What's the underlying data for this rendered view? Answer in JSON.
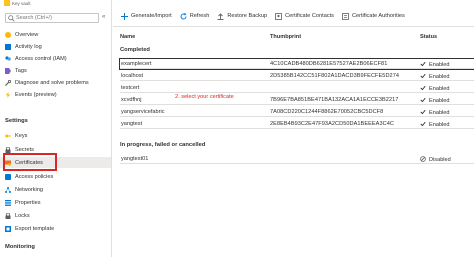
{
  "sidebar": {
    "brand": "Key vault",
    "search_placeholder": "Search (Ctrl+/)",
    "collapse_icon": "chevron-double-left-icon",
    "items": [
      {
        "label": "Overview",
        "icon": "overview-icon",
        "color": "#ffb900"
      },
      {
        "label": "Activity log",
        "icon": "activity-log-icon",
        "color": "#0078d4"
      },
      {
        "label": "Access control (IAM)",
        "icon": "iam-icon",
        "color": "#0078d4"
      },
      {
        "label": "Tags",
        "icon": "tag-icon",
        "color": "#7a5fc7"
      },
      {
        "label": "Diagnose and solve problems",
        "icon": "wrench-icon",
        "color": "#605e5c"
      },
      {
        "label": "Events (preview)",
        "icon": "lightning-icon",
        "color": "#ffb900"
      }
    ],
    "settings_heading": "Settings",
    "settings_items": [
      {
        "label": "Keys",
        "icon": "key-icon",
        "color": "#ffb900"
      },
      {
        "label": "Secrets",
        "icon": "secret-icon",
        "color": "#605e5c"
      },
      {
        "label": "Certificates",
        "icon": "certificate-icon",
        "color": "#e8712a"
      },
      {
        "label": "Access policies",
        "icon": "access-policy-icon",
        "color": "#0078d4"
      },
      {
        "label": "Networking",
        "icon": "network-icon",
        "color": "#0078d4"
      },
      {
        "label": "Properties",
        "icon": "properties-icon",
        "color": "#0078d4"
      },
      {
        "label": "Locks",
        "icon": "lock-icon",
        "color": "#605e5c"
      },
      {
        "label": "Export template",
        "icon": "export-icon",
        "color": "#0078d4"
      }
    ],
    "monitoring_heading": "Monitoring"
  },
  "toolbar": {
    "generate": "Generate/Import",
    "refresh": "Refresh",
    "restore": "Restore Backup",
    "contacts": "Certificate Contacts",
    "authorities": "Certificate Authorities"
  },
  "table": {
    "headers": {
      "name": "Name",
      "thumbprint": "Thumbprint",
      "status": "Status"
    },
    "completed_label": "Completed",
    "completed": [
      {
        "name": "examplecert",
        "thumbprint": "4C10CADB480DB6281E57527AE2B06ECF81",
        "status": "Enabled"
      },
      {
        "name": "localhost",
        "thumbprint": "2D5385B142CC51F802A1DACD3B9FECFE5D274",
        "status": "Enabled"
      },
      {
        "name": "testcert",
        "thumbprint": "",
        "status": "Enabled"
      },
      {
        "name": "xcvdfhnj",
        "thumbprint": "7B96E7BA851BE471BA132ACA1A1ECCE3B2217",
        "status": "Enabled"
      },
      {
        "name": "yangservicefabric",
        "thumbprint": "7A08CD220C1244F8862E70052CBC5DCF8",
        "status": "Enabled"
      },
      {
        "name": "yangtest",
        "thumbprint": "2E8EB4B93C2E47F93A2CD50DA1BEEEA3C4C",
        "status": "Enabled"
      }
    ],
    "pending_label": "In progress, failed or cancelled",
    "pending": [
      {
        "name": "yangtest01",
        "thumbprint": "",
        "status": "Disabled"
      }
    ]
  },
  "callout": "2. select your certificate",
  "colors": {
    "highlight": "#d92727",
    "accent": "#0078d4",
    "enabled": "#323130"
  }
}
